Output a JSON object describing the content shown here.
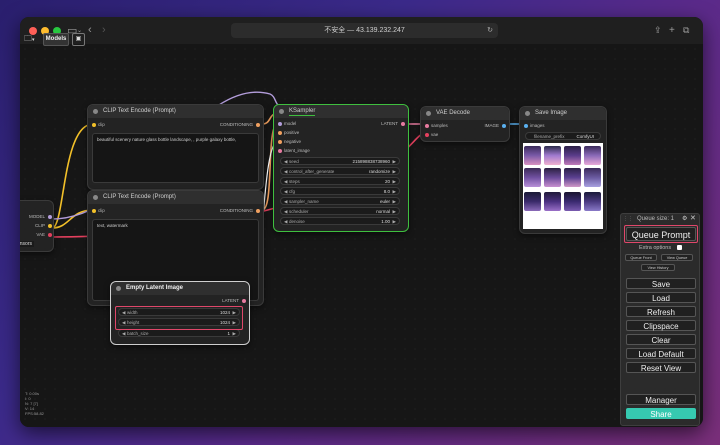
{
  "browser": {
    "url_text": "不安全 — 43.139.232.247"
  },
  "toolbar": {
    "models_label": "Models"
  },
  "nodes": {
    "clip_pos": {
      "title": "CLIP Text Encode (Prompt)",
      "input_clip": "clip",
      "output": "CONDITIONING",
      "text": "beautiful scenery nature glass bottle landscape, , purple galaxy bottle,"
    },
    "clip_neg": {
      "title": "CLIP Text Encode (Prompt)",
      "input_clip": "clip",
      "output": "CONDITIONING",
      "text": "text, watermark"
    },
    "ksampler": {
      "title": "KSampler",
      "inputs": [
        "model",
        "positive",
        "negative",
        "latent_image"
      ],
      "output": "LATENT",
      "widgets": [
        {
          "label": "seed",
          "value": "215898838738960"
        },
        {
          "label": "control_after_generate",
          "value": "randomize"
        },
        {
          "label": "steps",
          "value": "20"
        },
        {
          "label": "cfg",
          "value": "8.0"
        },
        {
          "label": "sampler_name",
          "value": "euler"
        },
        {
          "label": "scheduler",
          "value": "normal"
        },
        {
          "label": "denoise",
          "value": "1.00"
        }
      ]
    },
    "vae_decode": {
      "title": "VAE Decode",
      "inputs": [
        "samples",
        "vae"
      ],
      "output": "IMAGE"
    },
    "save_image": {
      "title": "Save Image",
      "input": "images",
      "widget_label": "filename_prefix",
      "widget_value": "ComfyUI"
    },
    "empty_latent": {
      "title": "Empty Latent Image",
      "output": "LATENT",
      "widgets": [
        {
          "label": "width",
          "value": "1024"
        },
        {
          "label": "height",
          "value": "1024"
        },
        {
          "label": "batch_size",
          "value": "1"
        }
      ]
    },
    "checkpoint": {
      "outputs": [
        "MODEL",
        "CLIP",
        "VAE"
      ],
      "partial_label": "ensors"
    }
  },
  "panel": {
    "queue_size": "Queue size: 1",
    "queue_prompt": "Queue Prompt",
    "extra_options": "Extra options",
    "queue_front": "Queue Front",
    "view_queue": "View Queue",
    "view_history": "View History",
    "save": "Save",
    "load": "Load",
    "refresh": "Refresh",
    "clipspace": "Clipspace",
    "clear": "Clear",
    "load_default": "Load Default",
    "reset_view": "Reset View",
    "manager": "Manager",
    "share": "Share"
  },
  "status_lines": [
    "T: 0.00s",
    "I: 0",
    "N: 7 [7]",
    "V: 14",
    "FPS:58.82"
  ],
  "colors": {
    "highlight": "#e0476a",
    "ksampler_border": "#3fbf3f",
    "share_button": "#36c9b0",
    "link_clip": "#f2c029",
    "link_conditioning": "#f0a060",
    "link_latent": "#e87ba0",
    "link_vae": "#e4405e",
    "link_image": "#5ab0f0",
    "link_model": "#b39ddb"
  }
}
